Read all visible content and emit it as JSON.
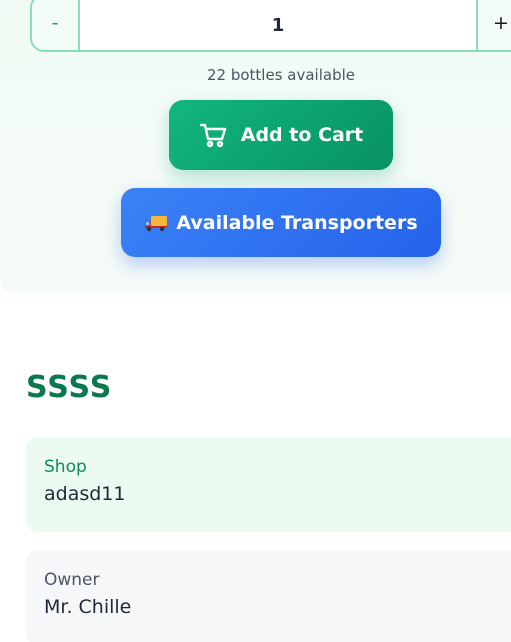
{
  "quantity": {
    "decrement_label": "-",
    "value": "1",
    "increment_label": "+"
  },
  "availability_text": "22 bottles available",
  "buttons": {
    "add_to_cart": "Add to Cart",
    "transporters": "Available Transporters"
  },
  "icons": {
    "cart": "cart-icon",
    "transporters": "delivery-truck-icon"
  },
  "product": {
    "title": "SSSS"
  },
  "details": {
    "shop_label": "Shop",
    "shop_value": "adasd11",
    "owner_label": "Owner",
    "owner_value": "Mr. Chille"
  },
  "colors": {
    "accent_green": "#10b27a",
    "accent_blue": "#2f74f0",
    "title_green": "#0a7a4e"
  }
}
